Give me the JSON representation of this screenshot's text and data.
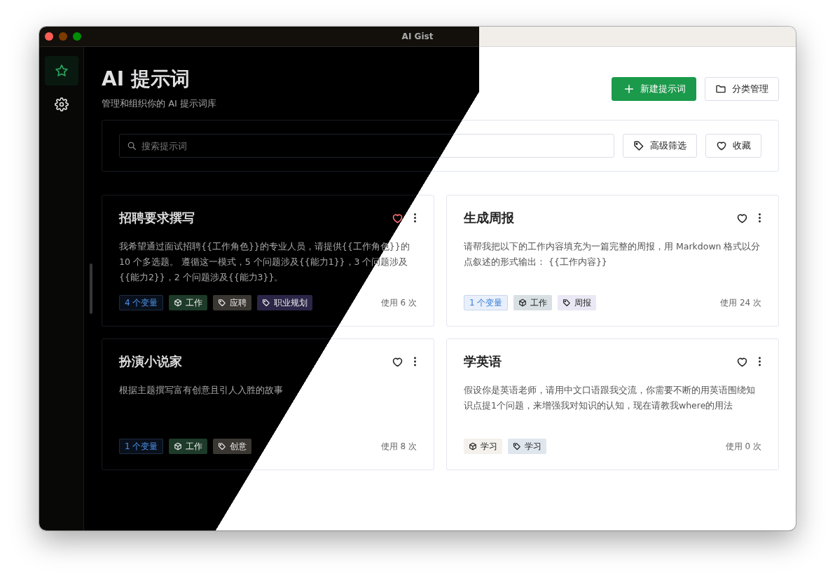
{
  "window": {
    "title": "AI Gist"
  },
  "sidebar": {
    "items": [
      {
        "kind": "star",
        "selected": true
      },
      {
        "kind": "gear",
        "selected": false
      }
    ]
  },
  "header": {
    "title": "AI 提示词",
    "subtitle": "管理和组织你的 AI 提示词库"
  },
  "actions": [
    {
      "label": "新建提示词",
      "kind": "primary"
    },
    {
      "label": "分类管理",
      "kind": "folder"
    }
  ],
  "search": {
    "placeholder": "搜索提示词"
  },
  "filters": [
    {
      "label": "高级筛选",
      "kind": "tag"
    },
    {
      "label": "收藏",
      "kind": "heart"
    }
  ],
  "cards": [
    {
      "title": "招聘要求撰写",
      "favorite": true,
      "description": "我希望通过面试招聘{{工作角色}}的专业人员，请提供{{工作角色}}的 10 个多选题。 遵循这一模式，5 个问题涉及{{能力1}}，3 个问题涉及{{能力2}}，2 个问题涉及{{能力3}}。",
      "variables": "4 个变量",
      "tags": [
        {
          "kind": "category",
          "label": "工作",
          "color": "#1e3a29"
        },
        {
          "kind": "tag",
          "label": "应聘",
          "color": "#3a3632"
        },
        {
          "kind": "tag",
          "label": "职业规划",
          "color": "#2b2547"
        }
      ],
      "usage": "使用 6 次"
    },
    {
      "title": "生成周报",
      "favorite": false,
      "description": "请帮我把以下的工作内容填充为一篇完整的周报，用 Markdown 格式以分点叙述的形式输出： {{工作内容}}",
      "variables": "1 个变量",
      "tags": [
        {
          "kind": "category",
          "label": "工作",
          "color": "#d8e0e4"
        },
        {
          "kind": "tag",
          "label": "周报",
          "color": "#eae8f4"
        }
      ],
      "usage": "使用 24 次"
    },
    {
      "title": "扮演小说家",
      "favorite": false,
      "description": "根据主题撰写富有创意且引人入胜的故事",
      "variables": "1 个变量",
      "tags": [
        {
          "kind": "category",
          "label": "工作",
          "color": "#1e3a29"
        },
        {
          "kind": "tag",
          "label": "创意",
          "color": "#3a3632"
        }
      ],
      "usage": "使用 8 次"
    },
    {
      "title": "学英语",
      "favorite": false,
      "description": "假设你是英语老师，请用中文口语跟我交流，你需要不断的用英语围绕知识点提1个问题，来增强我对知识的认知，现在请教我where的用法",
      "tags": [
        {
          "kind": "category",
          "label": "学习",
          "color": "#f4f1ec"
        },
        {
          "kind": "tag",
          "label": "学习",
          "color": "#dfe6ee"
        }
      ],
      "usage": "使用 0 次"
    }
  ]
}
